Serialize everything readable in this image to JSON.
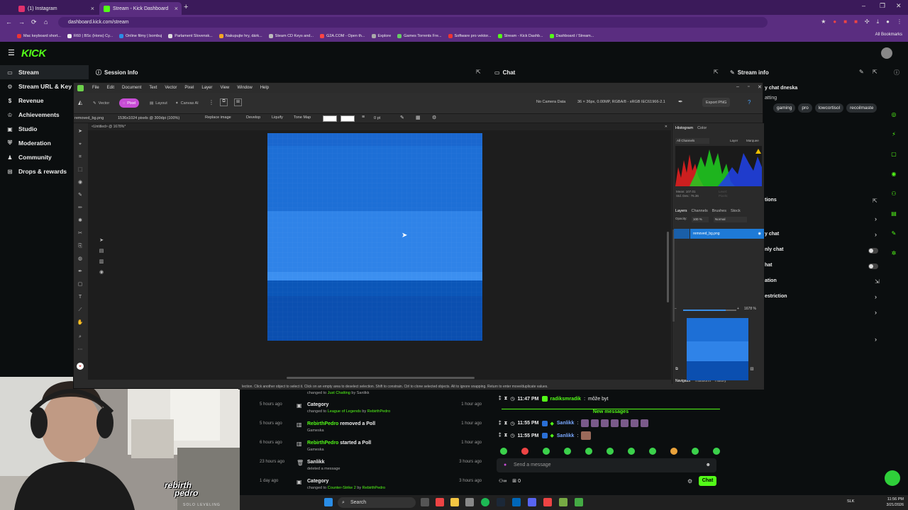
{
  "browser": {
    "tabs": [
      {
        "title": "(1) Instagram",
        "active": false
      },
      {
        "title": "Stream - Kick Dashboard",
        "active": true
      }
    ],
    "url": "dashboard.kick.com/stream",
    "bookmarks": [
      "Mac keyboard short...",
      "R60 | BSc (Hons) Cy...",
      "Online filmy | bombuj",
      "Parlament Slovensk...",
      "Nakupujte hry, dárk...",
      "Steam CD Keys and...",
      "G2A.COM - Open th...",
      "Explore",
      "Games Torrents Fre...",
      "Software pro vektor...",
      "Stream - Kick Dashb...",
      "Dashboard / Stream..."
    ],
    "all_bookmarks": "All Bookmarks"
  },
  "kick": {
    "logo": "KICK",
    "sidebar": [
      {
        "label": "Stream",
        "icon": "stream-icon",
        "active": true
      },
      {
        "label": "Stream URL & Key",
        "icon": "key-icon"
      },
      {
        "label": "Revenue",
        "icon": "revenue-icon"
      },
      {
        "label": "Achievements",
        "icon": "trophy-icon"
      },
      {
        "label": "Studio",
        "icon": "studio-icon"
      },
      {
        "label": "Moderation",
        "icon": "shield-icon"
      },
      {
        "label": "Community",
        "icon": "community-icon"
      },
      {
        "label": "Drops & rewards",
        "icon": "gift-icon"
      }
    ],
    "panels": {
      "session_info": "Session Info",
      "chat": "Chat",
      "stream_info": "Stream info"
    },
    "stream_info_partial": "y chat dneska",
    "stream_info_partial2": "atting",
    "tags": [
      "gaming",
      "pro",
      "lowcortisol",
      "recoilmaste"
    ],
    "chat_settings_partial": "tions",
    "settings_rows": [
      {
        "label": "y chat",
        "type": "chevron"
      },
      {
        "label": "nly chat",
        "type": "toggle"
      },
      {
        "label": "hat",
        "type": "toggle"
      },
      {
        "label": "ation",
        "type": "link"
      },
      {
        "label": "estriction",
        "type": "chevron"
      }
    ]
  },
  "affinity": {
    "menu": [
      "File",
      "Edit",
      "Document",
      "Text",
      "Vector",
      "Pixel",
      "Layer",
      "View",
      "Window",
      "Help"
    ],
    "personas": [
      "Vector",
      "Pixel",
      "Layout",
      "Canvas AI"
    ],
    "no_camera": "No Camera Data",
    "doc_info": "36 × 36px, 0.00MP, RGBA/8 - sRGB IEC61966-2.1",
    "export": "Export PNG",
    "ctx_file": "removed_bg.png",
    "ctx_size": "1536x1024 pixels @ 300dpi (100%)",
    "ctx_buttons": [
      "Replace image",
      "Develop",
      "Liquify",
      "Tone Map"
    ],
    "ctx_stroke": "0 pt",
    "doc_tab": "<Untitled> @ 1678%*",
    "right_tabs_top": [
      "Histogram",
      "Color"
    ],
    "channels": "All Channels",
    "hist_layer": "Layer",
    "hist_marquee": "Marquee",
    "hist_mean": "Mean: 107.01",
    "hist_std": "Std. Dev.: 76.36",
    "hist_level": "Level:",
    "hist_pixels": "Pixels:",
    "layer_tabs": [
      "Layers",
      "Channels",
      "Brushes",
      "Stock"
    ],
    "opacity_label": "Opacity:",
    "opacity": "100 %",
    "blend": "Normal",
    "layer_name": "removed_bg.png",
    "nav_tabs": [
      "Navigator",
      "Transform",
      "History"
    ],
    "zoom": "1678 %",
    "status": "lection. Click another object to select it. Click on an empty area to deselect selection. Shift to constrain. Ctrl to clone selected objects. Alt to ignore snapping. Return to enter move/duplicate values."
  },
  "feed": [
    {
      "time": "",
      "title": "",
      "title_green": "",
      "sub": "changed to ",
      "sub_green": "Just Chatting",
      "sub_by": " by ",
      "sub_user": "Sanlikk",
      "ago": ""
    },
    {
      "time": "5 hours ago",
      "icon": "category-icon",
      "title": "Category",
      "sub": "changed to ",
      "sub_green": "League of Legends",
      "sub_by": " by ",
      "sub_user": "RebirthPedro",
      "ago": "1 hour ago"
    },
    {
      "time": "5 hours ago",
      "icon": "poll-icon",
      "title_green": "RebirthPedro",
      "title": " removed a Poll",
      "sub": "Gameska",
      "ago": "1 hour ago"
    },
    {
      "time": "6 hours ago",
      "icon": "poll-icon",
      "title_green": "RebirthPedro",
      "title": " started a Poll",
      "sub": "Gameska",
      "ago": "1 hour ago"
    },
    {
      "time": "23 hours ago",
      "icon": "trash-icon",
      "title": "Sanlikk",
      "sub": "deleted a message",
      "ago": "3 hours ago"
    },
    {
      "time": "1 day ago",
      "icon": "category-icon",
      "title": "Category",
      "sub": "changed to ",
      "sub_green": "Counter-Strike 2",
      "sub_by": " by ",
      "sub_user": "RebirthPedro",
      "ago": "3 hours ago"
    }
  ],
  "chat": {
    "messages": [
      {
        "time": "11:47 PM",
        "user": "radiksmradik",
        "text": "môže byt",
        "color": "green"
      },
      {
        "time": "11:55 PM",
        "user": "Sanlikk",
        "text": "",
        "color": "blue"
      },
      {
        "time": "11:55 PM",
        "user": "Sanlikk",
        "text": "",
        "color": "blue"
      }
    ],
    "new_messages": "New messages",
    "placeholder": "Send a message",
    "send": "Chat",
    "count": "0"
  },
  "webcam": {
    "logo_line1": "rebirth",
    "logo_line2": "pedro",
    "sub": "SOLO LEVELING"
  },
  "taskbar": {
    "search": "Search",
    "lang": "SLK",
    "time": "11:56 PM",
    "date": "3/21/2026"
  },
  "colors": {
    "kick_green": "#53fc18",
    "browser_purple": "#5a2d80",
    "canvas_blue": "#1e6fd8",
    "affinity_pink": "#c84dd6"
  }
}
